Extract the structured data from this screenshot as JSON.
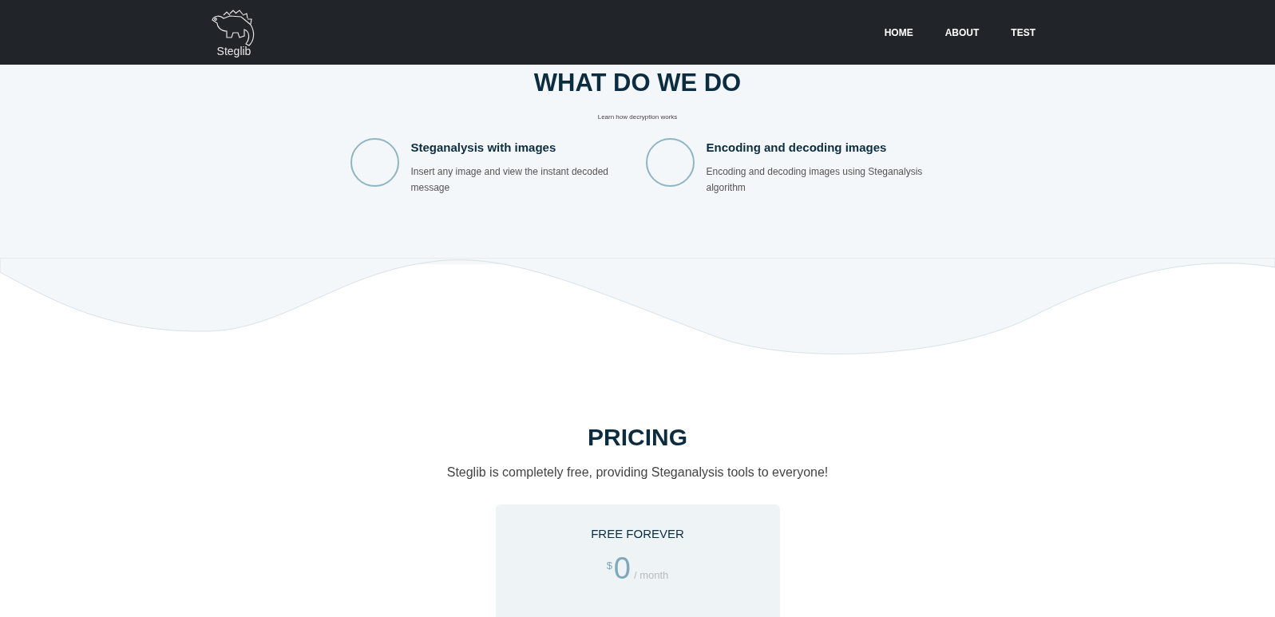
{
  "header": {
    "logo_text": "Steglib",
    "nav": [
      {
        "label": "HOME"
      },
      {
        "label": "ABOUT"
      },
      {
        "label": "TEST"
      }
    ]
  },
  "services": {
    "title": "WHAT DO WE DO",
    "subtitle": "Learn how decryption works",
    "items": [
      {
        "title": "Steganalysis with images",
        "text": "Insert any image and view the instant decoded message"
      },
      {
        "title": "Encoding and decoding images",
        "text": "Encoding and decoding images using Steganalysis algorithm"
      }
    ]
  },
  "pricing": {
    "title": "PRICING",
    "text": "Steglib is completely free, providing Steganalysis tools to everyone!",
    "plan": {
      "name": "FREE FOREVER",
      "currency": "$",
      "amount": "0",
      "period": "/ month"
    }
  }
}
